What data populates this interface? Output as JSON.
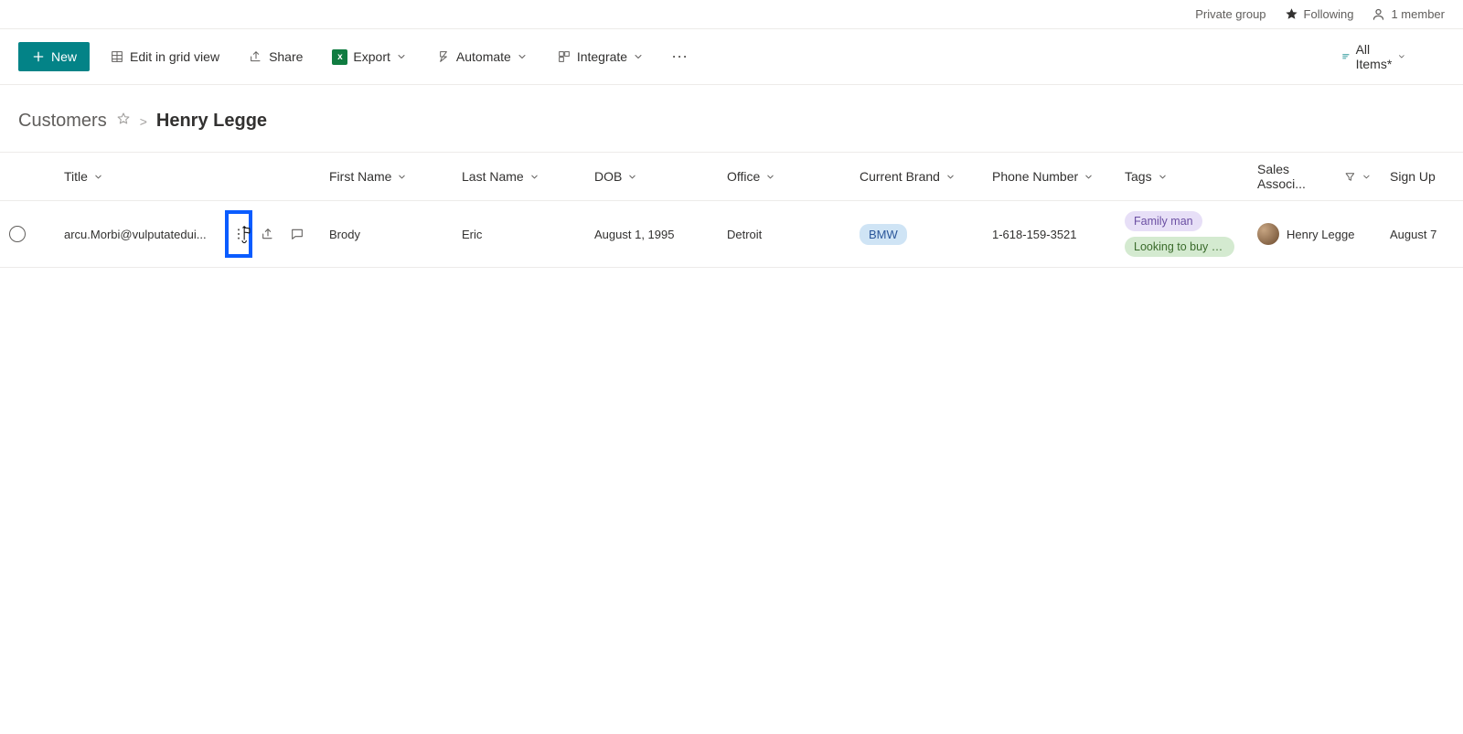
{
  "top": {
    "privacy": "Private group",
    "following": "Following",
    "members": "1 member"
  },
  "toolbar": {
    "new": "New",
    "edit_grid": "Edit in grid view",
    "share": "Share",
    "export": "Export",
    "automate": "Automate",
    "integrate": "Integrate",
    "all_items": "All Items*"
  },
  "breadcrumb": {
    "root": "Customers",
    "leaf": "Henry Legge"
  },
  "columns": {
    "title": "Title",
    "first_name": "First Name",
    "last_name": "Last Name",
    "dob": "DOB",
    "office": "Office",
    "current_brand": "Current Brand",
    "phone": "Phone Number",
    "tags": "Tags",
    "assoc": "Sales Associ...",
    "signup": "Sign Up"
  },
  "row": {
    "title": "arcu.Morbi@vulputatedui...",
    "first_name": "Brody",
    "last_name": "Eric",
    "dob": "August 1, 1995",
    "office": "Detroit",
    "brand": "BMW",
    "phone": "1-618-159-3521",
    "tag1": "Family man",
    "tag2": "Looking to buy s...",
    "assoc_name": "Henry Legge",
    "signup": "August 7"
  }
}
